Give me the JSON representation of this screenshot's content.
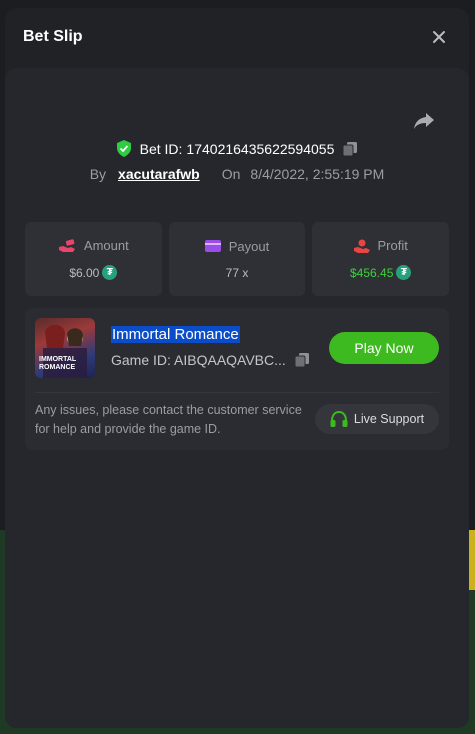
{
  "modal": {
    "title": "Bet Slip"
  },
  "bet": {
    "id_label": "Bet ID:",
    "id_value": "1740216435622594055",
    "by_label": "By",
    "user": "xacutarafwb",
    "on_label": "On",
    "date": "8/4/2022, 2:55:19 PM"
  },
  "stats": [
    {
      "label": "Amount",
      "value": "$6.00",
      "icon": "money-hand-icon",
      "coin": true
    },
    {
      "label": "Payout",
      "value": "77 x",
      "icon": "card-icon",
      "coin": false
    },
    {
      "label": "Profit",
      "value": "$456.45",
      "icon": "profit-hand-icon",
      "coin": true
    }
  ],
  "game": {
    "name": "Immortal Romance",
    "thumb_text": "IMMORTAL ROMANCE",
    "id_text": "Game ID: AIBQAAQAVBC...",
    "play_label": "Play Now",
    "help_text": "Any issues, please contact the customer service for help and provide the game ID.",
    "support_label": "Live Support"
  },
  "colors": {
    "accent_green": "#3dba1f",
    "profit_green": "#3dd13d",
    "selection_blue": "#0b4dc8",
    "usdt": "#26a17b"
  }
}
